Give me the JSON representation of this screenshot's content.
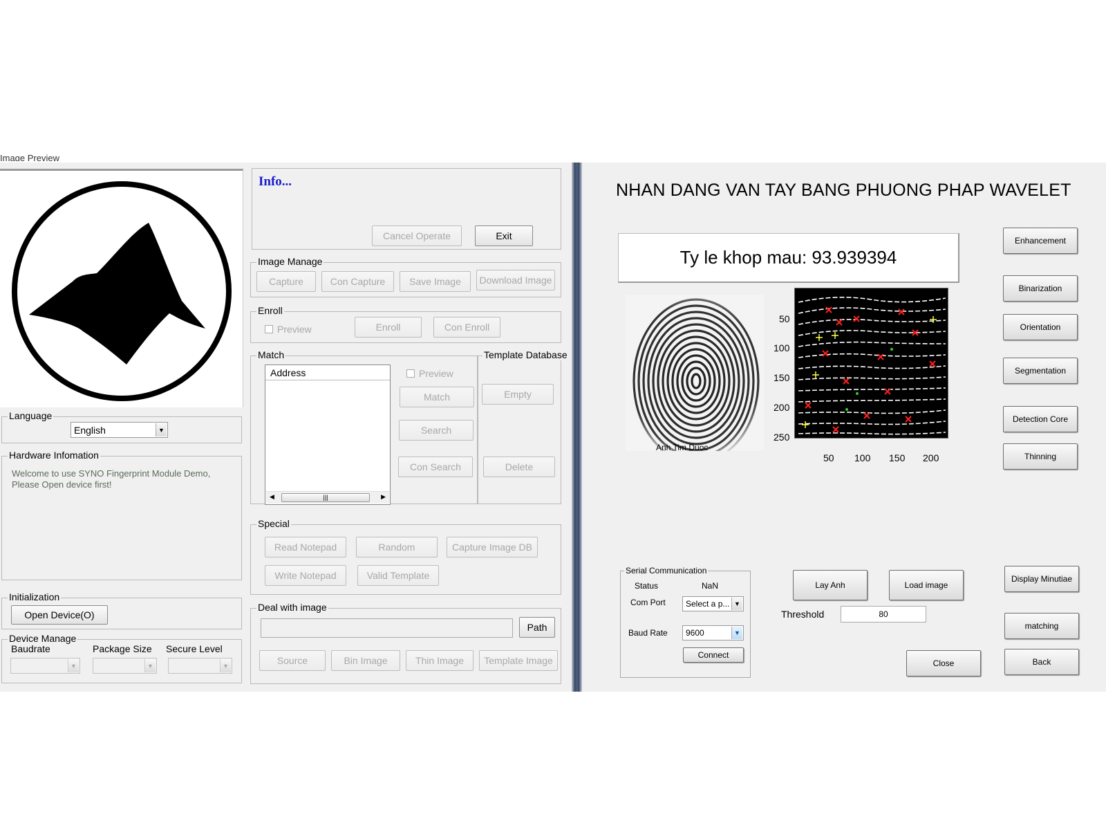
{
  "left_app": {
    "image_preview_label": "Image Preview",
    "info": {
      "title": "Info...",
      "cancel_operate": "Cancel Operate",
      "exit": "Exit"
    },
    "image_manage": {
      "label": "Image Manage",
      "capture": "Capture",
      "con_capture": "Con Capture",
      "save_image": "Save Image",
      "download_image": "Download Image"
    },
    "enroll": {
      "label": "Enroll",
      "preview": "Preview",
      "enroll": "Enroll",
      "con_enroll": "Con Enroll"
    },
    "match": {
      "label": "Match",
      "list_header": "Address",
      "preview": "Preview",
      "match": "Match",
      "search": "Search",
      "con_search": "Con Search"
    },
    "template_db": {
      "label": "Template Database",
      "empty": "Empty",
      "delete": "Delete"
    },
    "special": {
      "label": "Special",
      "read_notepad": "Read Notepad",
      "random": "Random",
      "capture_image_db": "Capture Image DB",
      "write_notepad": "Write Notepad",
      "valid_template": "Valid Template"
    },
    "deal": {
      "label": "Deal with image",
      "path_value": "",
      "path": "Path",
      "source": "Source",
      "bin_image": "Bin Image",
      "thin_image": "Thin Image",
      "template_image": "Template Image"
    },
    "language": {
      "label": "Language",
      "value": "English"
    },
    "hardware": {
      "label": "Hardware Infomation",
      "message": "Welcome to use SYNO Fingerprint Module Demo,\nPlease Open device first!"
    },
    "initialization": {
      "label": "Initialization",
      "open_device": "Open Device(O)"
    },
    "device_manage": {
      "label": "Device Manage",
      "baudrate": "Baudrate",
      "package_size": "Package Size",
      "secure_level": "Secure Level"
    }
  },
  "right_app": {
    "title": "NHAN DANG VAN TAY BANG PHUONG PHAP WAVELET",
    "match_rate": "Ty le khop mau: 93.939394",
    "image_caption": "Anh Tim Duoc",
    "y_ticks": [
      "50",
      "100",
      "150",
      "200",
      "250"
    ],
    "x_ticks": [
      "50",
      "100",
      "150",
      "200"
    ],
    "buttons": {
      "enhancement": "Enhancement",
      "binarization": "Binarization",
      "orientation": "Orientation",
      "segmentation": "Segmentation",
      "detection_core": "Detection Core",
      "thinning": "Thinning",
      "display_minutiae": "Display Minutiae",
      "matching": "matching",
      "back": "Back",
      "lay_anh": "Lay Anh",
      "load_image": "Load image",
      "close": "Close"
    },
    "serial": {
      "label": "Serial Communication",
      "status_label": "Status",
      "status_value": "NaN",
      "com_port_label": "Com Port",
      "com_port_value": "Select a p...",
      "baud_rate_label": "Baud Rate",
      "baud_rate_value": "9600",
      "connect": "Connect"
    },
    "threshold": {
      "label": "Threshold",
      "value": "80"
    }
  }
}
